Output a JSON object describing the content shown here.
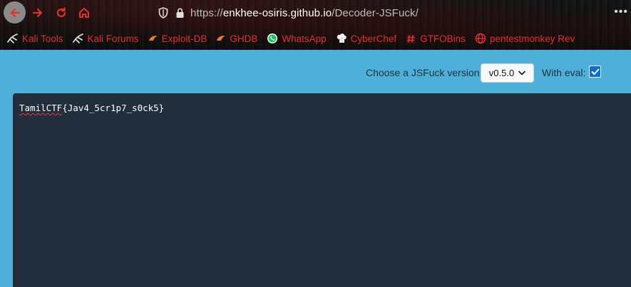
{
  "browser": {
    "url_scheme": "https://",
    "url_host": "enkhee-osiris.github.io",
    "url_path": "/Decoder-JSFuck/",
    "overflow": "•••",
    "accent_color": "#e3302d"
  },
  "bookmarks": [
    {
      "label": "Kali Tools",
      "icon": "kali-dragon-icon"
    },
    {
      "label": "Kali Forums",
      "icon": "kali-dragon-icon"
    },
    {
      "label": "Exploit-DB",
      "icon": "exploit-db-icon"
    },
    {
      "label": "GHDB",
      "icon": "ghdb-icon"
    },
    {
      "label": "WhatsApp",
      "icon": "whatsapp-icon"
    },
    {
      "label": "CyberChef",
      "icon": "cyberchef-icon"
    },
    {
      "label": "GTFOBins",
      "icon": "gtfobins-icon"
    },
    {
      "label": "pentestmonkey Rev",
      "icon": "globe-icon"
    }
  ],
  "page": {
    "version_label": "Choose a JSFuck version:",
    "version_selected": "v0.5.0",
    "eval_label": "With eval:",
    "eval_checked": true,
    "output_word": "TamilCTF",
    "output_rest": "{Jav4_5cr1p7_s0ck5}",
    "background_color": "#4eb0d9",
    "editor_color": "#222e3c"
  }
}
